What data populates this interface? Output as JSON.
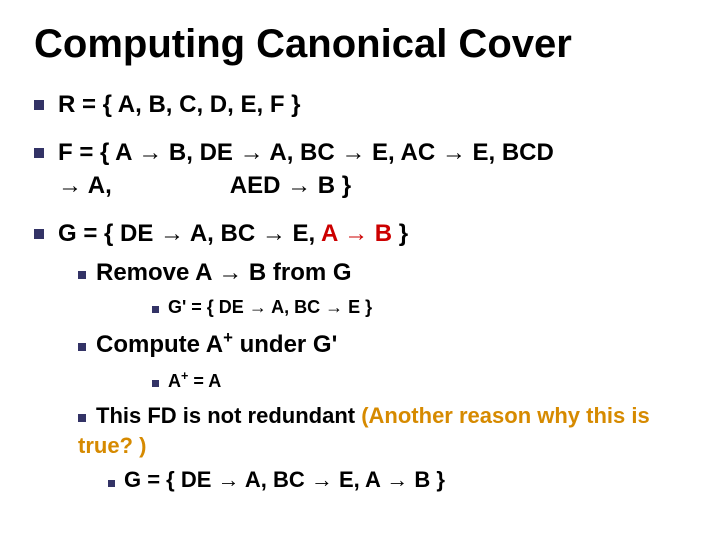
{
  "title": "Computing Canonical Cover",
  "items": {
    "r": "R = { A, B, C, D, E, F }",
    "f_pre": "F = { A ",
    "f_mid1": " B, DE ",
    "f_mid2": " A, BC ",
    "f_mid3": " E, AC ",
    "f_mid4": " E, BCD ",
    "f_mid5": " A,",
    "f_aed": "AED ",
    "f_end": " B }",
    "g_pre": "G = { DE ",
    "g_mid1": " A, BC ",
    "g_mid2": " E, ",
    "g_red_a": "A ",
    "g_red_b": " B",
    "g_end": " }",
    "remove_pre": "Remove A ",
    "remove_post": " B from G",
    "gprime_pre": "G' = { DE ",
    "gprime_mid": " A, BC ",
    "gprime_end": " E }",
    "compute_pre": "Compute A",
    "compute_post": " under G'",
    "aplus": "A",
    "aplus_eq": " = A",
    "notredund": "This FD is not redundant ",
    "another": "(Another reason why this is true? )",
    "gfinal_pre": "G = { DE ",
    "gfinal_mid1": " A, BC ",
    "gfinal_mid2": " E, A ",
    "gfinal_end": " B }"
  },
  "glyphs": {
    "arrow": "→",
    "plus": "+"
  }
}
